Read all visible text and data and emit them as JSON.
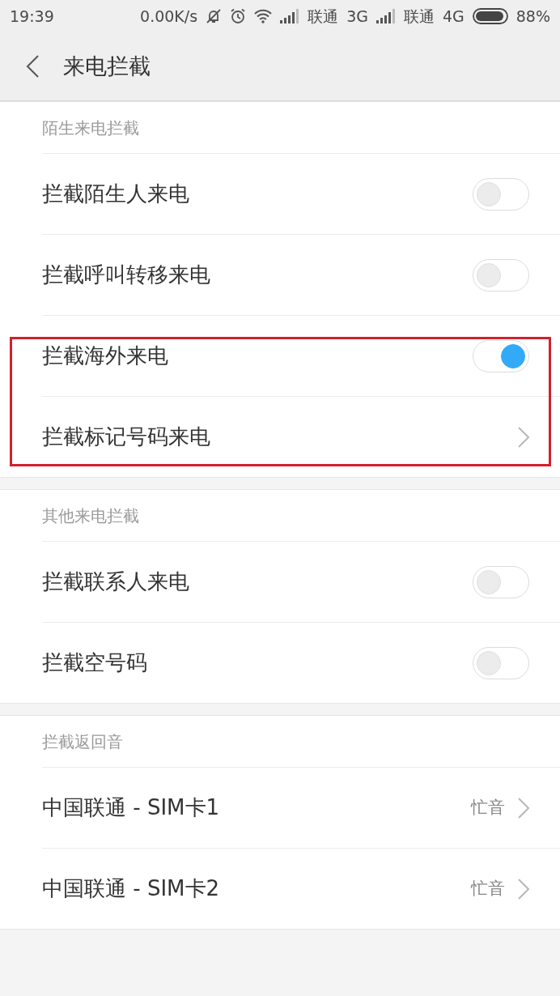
{
  "status_bar": {
    "time": "19:39",
    "net_speed": "0.00K/s",
    "sims": [
      {
        "carrier": "联通",
        "network": "3G"
      },
      {
        "carrier": "联通",
        "network": "4G"
      }
    ],
    "battery": "88%"
  },
  "header": {
    "title": "来电拦截"
  },
  "sections": [
    {
      "title": "陌生来电拦截",
      "rows": [
        {
          "kind": "toggle",
          "label": "拦截陌生人来电",
          "on": false,
          "highlighted": false
        },
        {
          "kind": "toggle",
          "label": "拦截呼叫转移来电",
          "on": false,
          "highlighted": false
        },
        {
          "kind": "toggle",
          "label": "拦截海外来电",
          "on": true,
          "highlighted": true
        },
        {
          "kind": "link",
          "label": "拦截标记号码来电",
          "highlighted": true
        }
      ]
    },
    {
      "title": "其他来电拦截",
      "rows": [
        {
          "kind": "toggle",
          "label": "拦截联系人来电",
          "on": false,
          "highlighted": false
        },
        {
          "kind": "toggle",
          "label": "拦截空号码",
          "on": false,
          "highlighted": false
        }
      ]
    },
    {
      "title": "拦截返回音",
      "rows": [
        {
          "kind": "link",
          "label": "中国联通 - SIM卡1",
          "value": "忙音",
          "highlighted": false
        },
        {
          "kind": "link",
          "label": "中国联通 - SIM卡2",
          "value": "忙音",
          "highlighted": false
        }
      ]
    }
  ]
}
